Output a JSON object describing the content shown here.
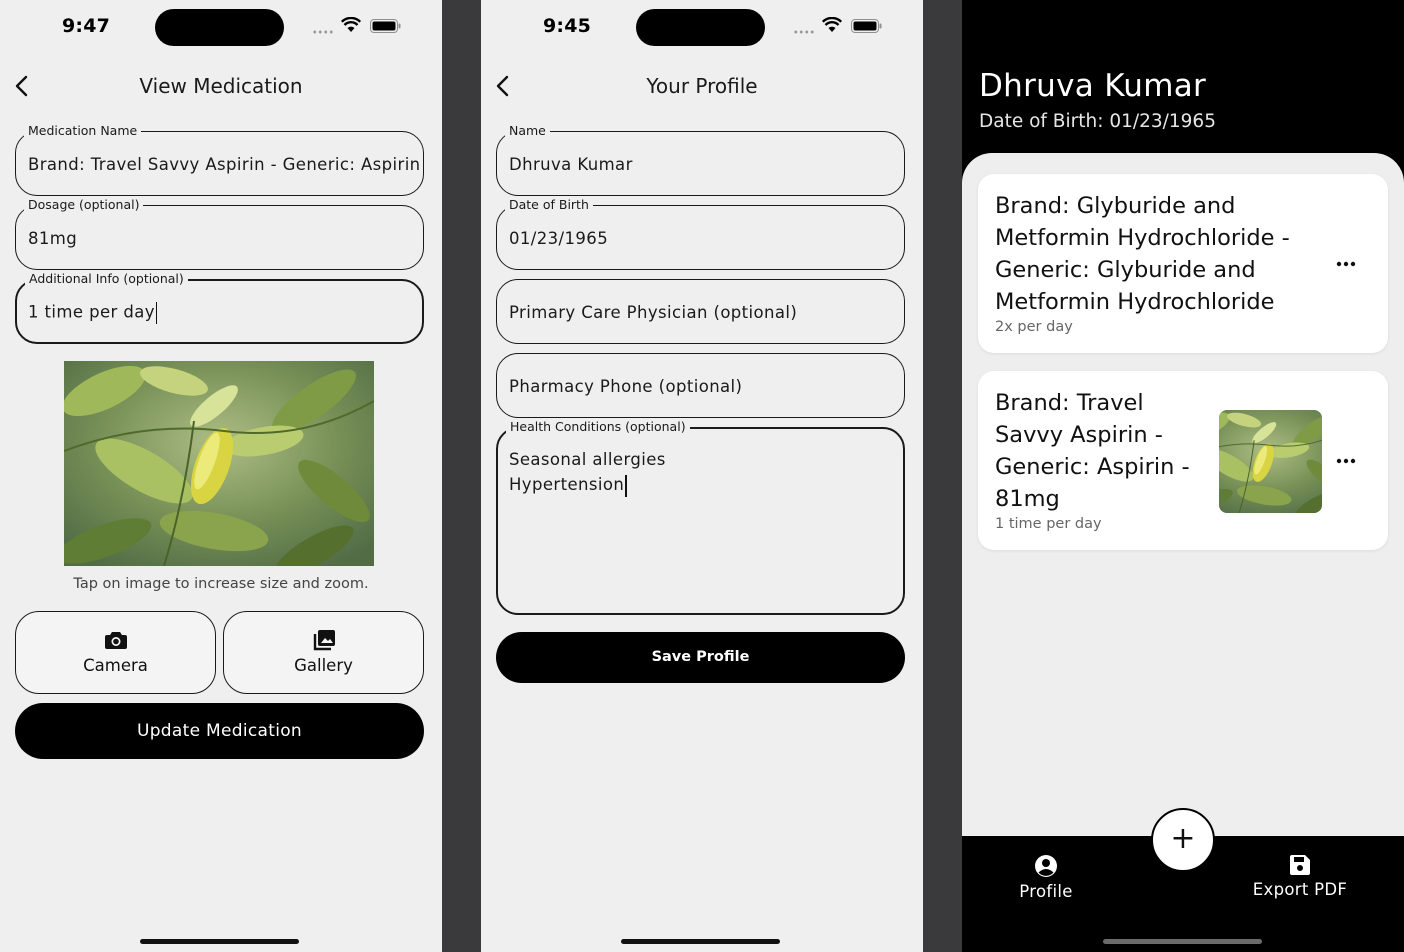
{
  "screen1": {
    "time": "9:47",
    "title": "View Medication",
    "fields": {
      "medication_name": {
        "label": "Medication Name",
        "value": "Brand: Travel Savvy Aspirin - Generic: Aspirin"
      },
      "dosage": {
        "label": "Dosage (optional)",
        "value": "81mg"
      },
      "additional_info": {
        "label": "Additional Info (optional)",
        "value": "1 time per day"
      }
    },
    "image_hint": "Tap on image to increase size and zoom.",
    "camera_label": "Camera",
    "gallery_label": "Gallery",
    "update_label": "Update Medication"
  },
  "screen2": {
    "time": "9:45",
    "title": "Your Profile",
    "fields": {
      "name": {
        "label": "Name",
        "value": "Dhruva Kumar"
      },
      "dob": {
        "label": "Date of Birth",
        "value": "01/23/1965"
      },
      "pcp": {
        "placeholder": "Primary Care Physician (optional)"
      },
      "pharmacy": {
        "placeholder": "Pharmacy Phone (optional)"
      },
      "health": {
        "label": "Health Conditions (optional)",
        "line1": "Seasonal allergies",
        "line2": "Hypertension"
      }
    },
    "save_label": "Save Profile"
  },
  "screen3": {
    "name": "Dhruva Kumar",
    "dob": "Date of Birth: 01/23/1965",
    "meds": [
      {
        "lines": [
          "Brand: Glyburide and",
          "Metformin Hydrochloride -",
          "Generic: Glyburide and",
          "Metformin Hydrochloride"
        ],
        "freq": "2x per day",
        "has_image": false
      },
      {
        "lines": [
          "Brand: Travel",
          "Savvy Aspirin -",
          "Generic: Aspirin -",
          "81mg"
        ],
        "freq": "1 time per day",
        "has_image": true
      }
    ],
    "fab_label": "+",
    "tabs": {
      "profile": "Profile",
      "export": "Export PDF"
    }
  },
  "icons": {
    "back": "chevron-left-icon",
    "camera": "camera-icon",
    "gallery": "gallery-icon",
    "more": "ellipsis-icon",
    "profile": "account-circle-icon",
    "export": "save-icon",
    "wifi": "wifi-icon",
    "battery": "battery-icon"
  },
  "colors": {
    "background": "#efefef",
    "primary": "#000000",
    "card": "#ffffff",
    "muted": "#666666"
  }
}
